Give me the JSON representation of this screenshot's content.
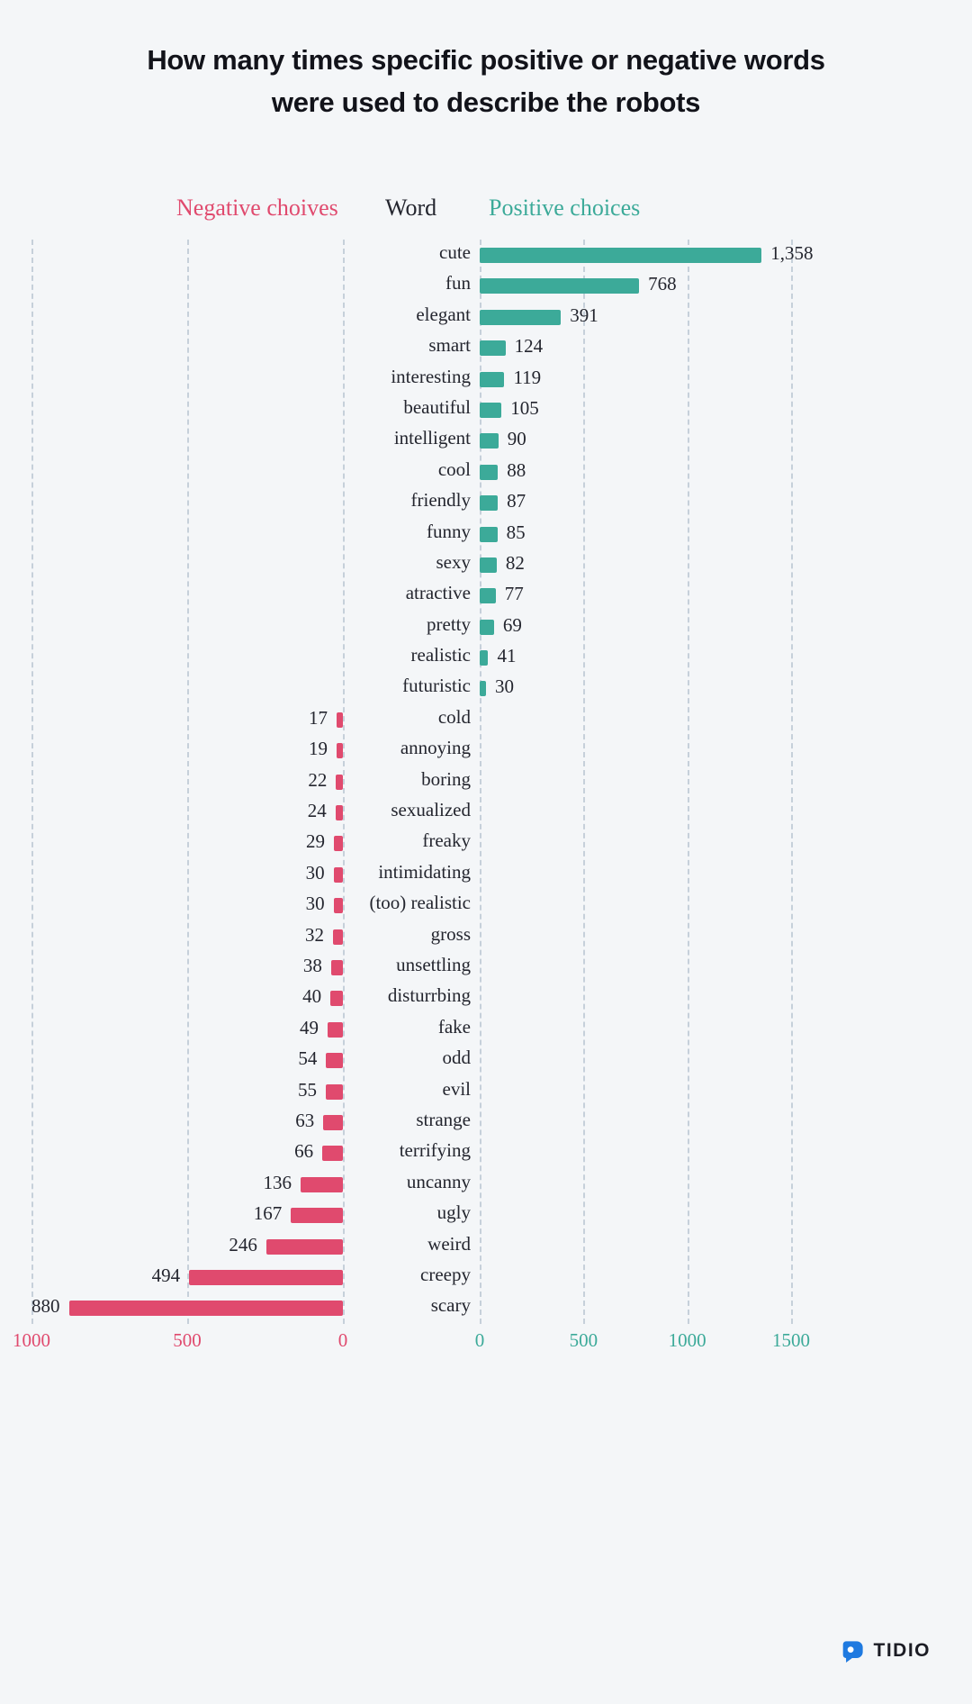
{
  "title": "How many times specific positive or negative words were used to describe the robots",
  "headers": {
    "negative": "Negative choives",
    "word": "Word",
    "positive": "Positive choices"
  },
  "colors": {
    "negative": "#e04a6e",
    "positive": "#3caa99",
    "background": "#f4f6f8",
    "text": "#24262f",
    "grid": "#c6d0da"
  },
  "footer": {
    "brand": "TIDIO",
    "logo_icon": "tidio-chat-bubble-icon"
  },
  "axis": {
    "negative_ticks": [
      "1000",
      "500",
      "0"
    ],
    "positive_ticks": [
      "0",
      "500",
      "1000",
      "1500"
    ],
    "negative_max": 1000,
    "positive_max": 1500
  },
  "chart_data": {
    "type": "bar",
    "title": "How many times specific positive or negative words were used to describe the robots",
    "xlabel": "",
    "ylabel": "Word",
    "orientation": "horizontal",
    "layout": "diverging-dual-axis",
    "grid": true,
    "legend_position": "top",
    "categories": [
      "cute",
      "fun",
      "elegant",
      "smart",
      "interesting",
      "beautiful",
      "intelligent",
      "cool",
      "friendly",
      "funny",
      "sexy",
      "atractive",
      "pretty",
      "realistic",
      "futuristic",
      "cold",
      "annoying",
      "boring",
      "sexualized",
      "freaky",
      "intimidating",
      "(too) realistic",
      "gross",
      "unsettling",
      "disturrbing",
      "fake",
      "odd",
      "evil",
      "strange",
      "terrifying",
      "uncanny",
      "ugly",
      "weird",
      "creepy",
      "scary"
    ],
    "series": [
      {
        "name": "Positive choices",
        "color": "#3caa99",
        "values": [
          1358,
          768,
          391,
          124,
          119,
          105,
          90,
          88,
          87,
          85,
          82,
          77,
          69,
          41,
          30,
          null,
          null,
          null,
          null,
          null,
          null,
          null,
          null,
          null,
          null,
          null,
          null,
          null,
          null,
          null,
          null,
          null,
          null,
          null,
          null
        ],
        "labels": [
          "1,358",
          "768",
          "391",
          "124",
          "119",
          "105",
          "90",
          "88",
          "87",
          "85",
          "82",
          "77",
          "69",
          "41",
          "30",
          "",
          "",
          "",
          "",
          "",
          "",
          "",
          "",
          "",
          "",
          "",
          "",
          "",
          "",
          "",
          "",
          "",
          "",
          "",
          ""
        ]
      },
      {
        "name": "Negative choives",
        "color": "#e04a6e",
        "values": [
          null,
          null,
          null,
          null,
          null,
          null,
          null,
          null,
          null,
          null,
          null,
          null,
          null,
          null,
          null,
          17,
          19,
          22,
          24,
          29,
          30,
          30,
          32,
          38,
          40,
          49,
          54,
          55,
          63,
          66,
          136,
          167,
          246,
          494,
          880
        ],
        "labels": [
          "",
          "",
          "",
          "",
          "",
          "",
          "",
          "",
          "",
          "",
          "",
          "",
          "",
          "",
          "",
          "17",
          "19",
          "22",
          "24",
          "29",
          "30",
          "30",
          "32",
          "38",
          "40",
          "49",
          "54",
          "55",
          "63",
          "66",
          "136",
          "167",
          "246",
          "494",
          "880"
        ]
      }
    ],
    "xlim_negative": [
      1000,
      0
    ],
    "xlim_positive": [
      0,
      1500
    ]
  }
}
